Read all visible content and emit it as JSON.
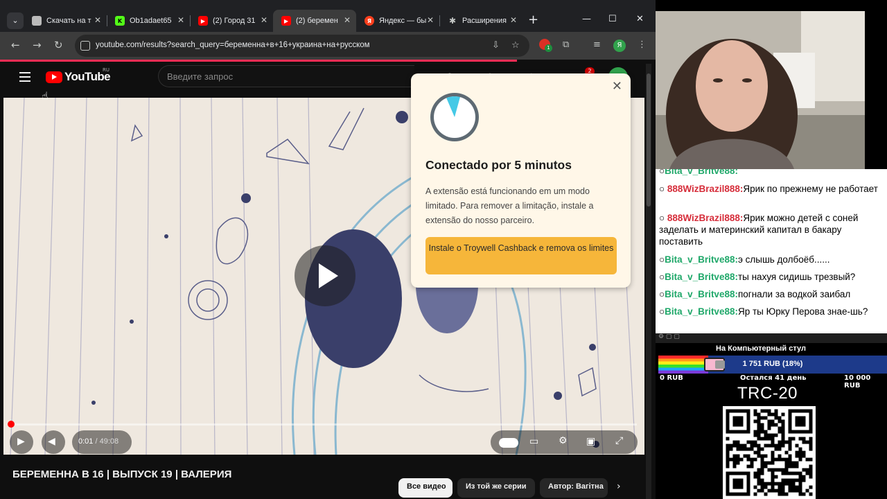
{
  "browser": {
    "tabs": [
      {
        "title": "Скачать на т",
        "favicon_color": "#bbbbbb",
        "active": false
      },
      {
        "title": "Ob1adaet65",
        "favicon_color": "#53fc18",
        "active": false
      },
      {
        "title": "(2) Город 31",
        "favicon_color": "#ff0000",
        "active": false
      },
      {
        "title": "(2) беремен",
        "favicon_color": "#ff0000",
        "active": true
      },
      {
        "title": "Яндекс — бы",
        "favicon_color": "#fc3f1d",
        "active": false
      },
      {
        "title": "Расширения",
        "favicon_color": "#bbbbbb",
        "active": false
      }
    ],
    "url": "youtube.com/results?search_query=беременна+в+16+украина+на+русском",
    "profile_initial": "Я",
    "extension_badge": "1"
  },
  "youtube": {
    "logo_text": "YouTube",
    "region": "RU",
    "search_placeholder": "Введите запрос",
    "notification_count": "2",
    "time_current": "0:01",
    "time_separator": "/",
    "time_total": "49:08",
    "progress_fraction": 0.0003,
    "video_title": "БЕРЕМЕННА В 16 | ВЫПУСК 19 | ВАЛЕРИЯ",
    "chips": [
      "Все видео",
      "Из той же серии",
      "Автор: Вагітна"
    ]
  },
  "popup": {
    "title": "Conectado por 5 minutos",
    "body": "A extensão está funcionando em um modo limitado. Para remover a limitação, instale a extensão do nosso parceiro.",
    "button": "Instale o Troywell Cashback e remova os limites"
  },
  "chat": {
    "messages": [
      {
        "user": "Bita_v_Britve88:",
        "text": "",
        "color": "green"
      },
      {
        "user": "888WizBrazil888:",
        "text": "Ярик по прежнему не работает",
        "color": "red"
      },
      {
        "user": "888WizBrazil888:",
        "text": "Ярик можно детей с соней заделать и материнский капитал в бакару поставить",
        "color": "red"
      },
      {
        "user": "Bita_v_Britve88:",
        "text": "э слышь долбоёб......",
        "color": "green"
      },
      {
        "user": "Bita_v_Britve88:",
        "text": "ты нахуя сидишь трезвый?",
        "color": "green"
      },
      {
        "user": "Bita_v_Britve88:",
        "text": "погнали за водкой заибал",
        "color": "green"
      },
      {
        "user": "Bita_v_Britve88:",
        "text": "Яр ты Юрку Перова знае-шь?",
        "color": "green"
      }
    ]
  },
  "donation_goal": {
    "title": "На Компьютерный стул",
    "amount_text": "1 751 RUB (18%)",
    "fraction": 0.18,
    "min_label": "0 RUB",
    "days_left": "Остался 41 день",
    "max_label": "10 000 RUB"
  },
  "wallet_label": "TRC-20"
}
